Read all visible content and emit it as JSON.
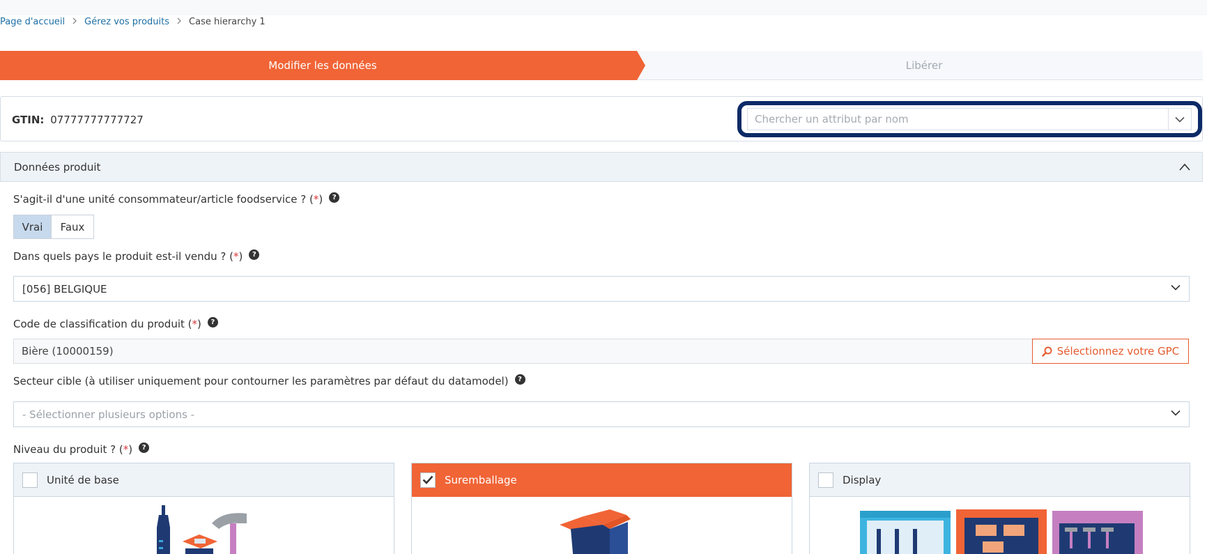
{
  "breadcrumb": {
    "home": "Page d'accueil",
    "products": "Gérez vos produits",
    "current": "Case hierarchy 1"
  },
  "stepper": {
    "active": "Modifier les données",
    "next": "Libérer"
  },
  "gtin": {
    "label": "GTIN:",
    "value": "07777777777727"
  },
  "search": {
    "placeholder": "Chercher un attribut par nom"
  },
  "panel": {
    "title": "Données produit"
  },
  "fields": {
    "consumer_unit": {
      "label": "S'agit-il d'une unité consommateur/article foodservice ? (",
      "required": "*",
      "label_end": ")",
      "option_true": "Vrai",
      "option_false": "Faux",
      "selected": "Vrai"
    },
    "countries": {
      "label": "Dans quels pays le produit est-il vendu ? (",
      "required": "*",
      "label_end": ")",
      "value": "[056] BELGIQUE"
    },
    "classification": {
      "label": "Code de classification du produit (",
      "required": "*",
      "label_end": ")",
      "value": "Bière (10000159)",
      "button": "Sélectionnez votre GPC"
    },
    "sector": {
      "label": "Secteur cible (à utiliser uniquement pour contourner les paramètres par défaut du datamodel)",
      "placeholder": "- Sélectionner plusieurs options -"
    },
    "level": {
      "label": "Niveau du produit ? (",
      "required": "*",
      "label_end": ")",
      "options": [
        {
          "label": "Unité de base",
          "checked": false
        },
        {
          "label": "Suremballage",
          "checked": true
        },
        {
          "label": "Display",
          "checked": false
        }
      ]
    }
  },
  "help_glyph": "?",
  "colors": {
    "accent": "#f06436",
    "link": "#1d6fa5",
    "focus_ring": "#0c2a66",
    "required": "#d9383a"
  }
}
